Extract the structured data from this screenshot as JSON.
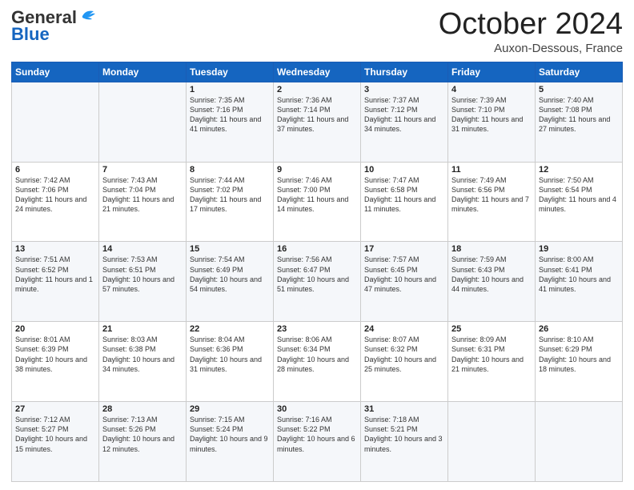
{
  "header": {
    "logo_general": "General",
    "logo_blue": "Blue",
    "month_title": "October 2024",
    "location": "Auxon-Dessous, France"
  },
  "weekdays": [
    "Sunday",
    "Monday",
    "Tuesday",
    "Wednesday",
    "Thursday",
    "Friday",
    "Saturday"
  ],
  "weeks": [
    [
      {
        "day": "",
        "info": ""
      },
      {
        "day": "",
        "info": ""
      },
      {
        "day": "1",
        "info": "Sunrise: 7:35 AM\nSunset: 7:16 PM\nDaylight: 11 hours and 41 minutes."
      },
      {
        "day": "2",
        "info": "Sunrise: 7:36 AM\nSunset: 7:14 PM\nDaylight: 11 hours and 37 minutes."
      },
      {
        "day": "3",
        "info": "Sunrise: 7:37 AM\nSunset: 7:12 PM\nDaylight: 11 hours and 34 minutes."
      },
      {
        "day": "4",
        "info": "Sunrise: 7:39 AM\nSunset: 7:10 PM\nDaylight: 11 hours and 31 minutes."
      },
      {
        "day": "5",
        "info": "Sunrise: 7:40 AM\nSunset: 7:08 PM\nDaylight: 11 hours and 27 minutes."
      }
    ],
    [
      {
        "day": "6",
        "info": "Sunrise: 7:42 AM\nSunset: 7:06 PM\nDaylight: 11 hours and 24 minutes."
      },
      {
        "day": "7",
        "info": "Sunrise: 7:43 AM\nSunset: 7:04 PM\nDaylight: 11 hours and 21 minutes."
      },
      {
        "day": "8",
        "info": "Sunrise: 7:44 AM\nSunset: 7:02 PM\nDaylight: 11 hours and 17 minutes."
      },
      {
        "day": "9",
        "info": "Sunrise: 7:46 AM\nSunset: 7:00 PM\nDaylight: 11 hours and 14 minutes."
      },
      {
        "day": "10",
        "info": "Sunrise: 7:47 AM\nSunset: 6:58 PM\nDaylight: 11 hours and 11 minutes."
      },
      {
        "day": "11",
        "info": "Sunrise: 7:49 AM\nSunset: 6:56 PM\nDaylight: 11 hours and 7 minutes."
      },
      {
        "day": "12",
        "info": "Sunrise: 7:50 AM\nSunset: 6:54 PM\nDaylight: 11 hours and 4 minutes."
      }
    ],
    [
      {
        "day": "13",
        "info": "Sunrise: 7:51 AM\nSunset: 6:52 PM\nDaylight: 11 hours and 1 minute."
      },
      {
        "day": "14",
        "info": "Sunrise: 7:53 AM\nSunset: 6:51 PM\nDaylight: 10 hours and 57 minutes."
      },
      {
        "day": "15",
        "info": "Sunrise: 7:54 AM\nSunset: 6:49 PM\nDaylight: 10 hours and 54 minutes."
      },
      {
        "day": "16",
        "info": "Sunrise: 7:56 AM\nSunset: 6:47 PM\nDaylight: 10 hours and 51 minutes."
      },
      {
        "day": "17",
        "info": "Sunrise: 7:57 AM\nSunset: 6:45 PM\nDaylight: 10 hours and 47 minutes."
      },
      {
        "day": "18",
        "info": "Sunrise: 7:59 AM\nSunset: 6:43 PM\nDaylight: 10 hours and 44 minutes."
      },
      {
        "day": "19",
        "info": "Sunrise: 8:00 AM\nSunset: 6:41 PM\nDaylight: 10 hours and 41 minutes."
      }
    ],
    [
      {
        "day": "20",
        "info": "Sunrise: 8:01 AM\nSunset: 6:39 PM\nDaylight: 10 hours and 38 minutes."
      },
      {
        "day": "21",
        "info": "Sunrise: 8:03 AM\nSunset: 6:38 PM\nDaylight: 10 hours and 34 minutes."
      },
      {
        "day": "22",
        "info": "Sunrise: 8:04 AM\nSunset: 6:36 PM\nDaylight: 10 hours and 31 minutes."
      },
      {
        "day": "23",
        "info": "Sunrise: 8:06 AM\nSunset: 6:34 PM\nDaylight: 10 hours and 28 minutes."
      },
      {
        "day": "24",
        "info": "Sunrise: 8:07 AM\nSunset: 6:32 PM\nDaylight: 10 hours and 25 minutes."
      },
      {
        "day": "25",
        "info": "Sunrise: 8:09 AM\nSunset: 6:31 PM\nDaylight: 10 hours and 21 minutes."
      },
      {
        "day": "26",
        "info": "Sunrise: 8:10 AM\nSunset: 6:29 PM\nDaylight: 10 hours and 18 minutes."
      }
    ],
    [
      {
        "day": "27",
        "info": "Sunrise: 7:12 AM\nSunset: 5:27 PM\nDaylight: 10 hours and 15 minutes."
      },
      {
        "day": "28",
        "info": "Sunrise: 7:13 AM\nSunset: 5:26 PM\nDaylight: 10 hours and 12 minutes."
      },
      {
        "day": "29",
        "info": "Sunrise: 7:15 AM\nSunset: 5:24 PM\nDaylight: 10 hours and 9 minutes."
      },
      {
        "day": "30",
        "info": "Sunrise: 7:16 AM\nSunset: 5:22 PM\nDaylight: 10 hours and 6 minutes."
      },
      {
        "day": "31",
        "info": "Sunrise: 7:18 AM\nSunset: 5:21 PM\nDaylight: 10 hours and 3 minutes."
      },
      {
        "day": "",
        "info": ""
      },
      {
        "day": "",
        "info": ""
      }
    ]
  ]
}
